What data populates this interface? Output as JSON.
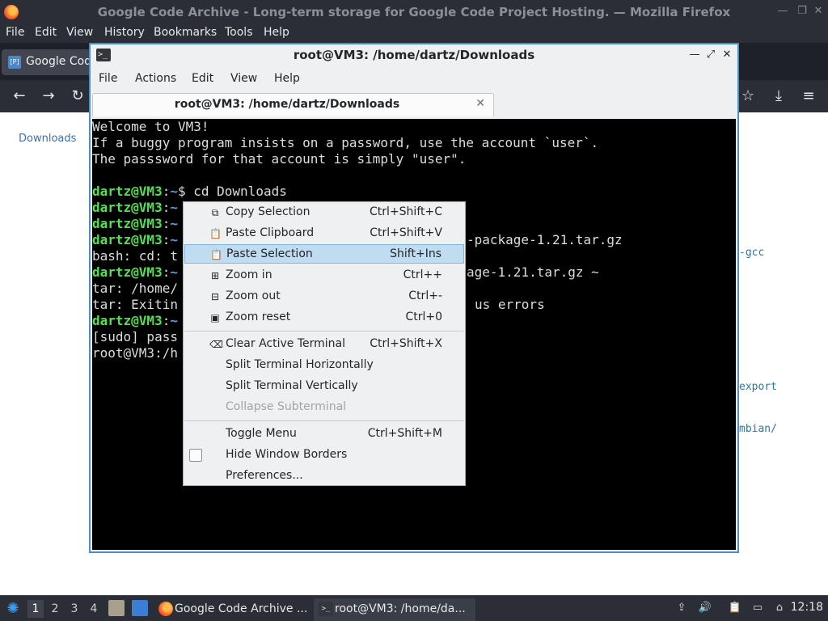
{
  "firefox": {
    "title": "Google Code Archive - Long-term storage for Google Code Project Hosting. — Mozilla Firefox",
    "menu": [
      "File",
      "Edit",
      "View",
      "History",
      "Bookmarks",
      "Tools",
      "Help"
    ],
    "tab_label": "Google Code",
    "tab_favicon": "[P]",
    "content": {
      "downloads_link": "Downloads",
      "side_text_1": "-gcc",
      "side_text_2": "export",
      "side_text_3": "mbian/"
    },
    "nav_icons": [
      "back-icon",
      "forward-icon",
      "reload-icon",
      "bookmark-star-icon",
      "download-icon",
      "hamburger-menu-icon"
    ]
  },
  "terminal": {
    "title": "root@VM3: /home/dartz/Downloads",
    "menu": [
      "File",
      "Actions",
      "Edit",
      "View",
      "Help"
    ],
    "tab_label": "root@VM3: /home/dartz/Downloads",
    "lines": {
      "l1": "Welcome to VM3!",
      "l2": "If a buggy program insists on a password, use the account `user`.",
      "l3": "The passsword for that account is simply \"user\".",
      "p1_user": "dartz@VM3",
      "p1_path": "~",
      "p1_cmd": "$ cd Downloads",
      "p2_user": "dartz@VM3",
      "p2_path": "~",
      "p3_user": "dartz@VM3",
      "p3_path": "~",
      "p4_user": "dartz@VM3",
      "p4_path": "~",
      "p4_tail": "-package-1.21.tar.gz",
      "l5_start": "bash: cd: t",
      "p6_user": "dartz@VM3",
      "p6_path": "~",
      "p6_tail": "age-1.21.tar.gz ~",
      "l7_start": "tar: /home/",
      "l8_start": "tar: Exitin",
      "l8_tail": "us errors",
      "p9_user": "dartz@VM3",
      "p9_path": "~",
      "l10_start": "[sudo] pass",
      "l11_start": "root@VM3:/h"
    }
  },
  "context_menu": {
    "items": [
      {
        "label": "Copy Selection",
        "shortcut": "Ctrl+Shift+C",
        "icon": "copy-icon"
      },
      {
        "label": "Paste Clipboard",
        "shortcut": "Ctrl+Shift+V",
        "icon": "paste-icon"
      },
      {
        "label": "Paste Selection",
        "shortcut": "Shift+Ins",
        "icon": "paste-icon"
      },
      {
        "label": "Zoom in",
        "shortcut": "Ctrl++",
        "icon": "zoom-in-icon"
      },
      {
        "label": "Zoom out",
        "shortcut": "Ctrl+-",
        "icon": "zoom-out-icon"
      },
      {
        "label": "Zoom reset",
        "shortcut": "Ctrl+0",
        "icon": "zoom-reset-icon"
      },
      {
        "label": "Clear Active Terminal",
        "shortcut": "Ctrl+Shift+X",
        "icon": "clear-icon"
      },
      {
        "label": "Split Terminal Horizontally",
        "shortcut": ""
      },
      {
        "label": "Split Terminal Vertically",
        "shortcut": ""
      },
      {
        "label": "Collapse Subterminal",
        "shortcut": "",
        "disabled": true
      },
      {
        "label": "Toggle Menu",
        "shortcut": "Ctrl+Shift+M"
      },
      {
        "label": "Hide Window Borders",
        "shortcut": "",
        "checkbox": true,
        "checked": false
      },
      {
        "label": "Preferences...",
        "shortcut": ""
      }
    ],
    "highlighted": "Paste Selection"
  },
  "taskbar": {
    "workspaces": [
      "1",
      "2",
      "3",
      "4"
    ],
    "active_workspace": "1",
    "tasks": [
      {
        "label": "Google Code Archive ...",
        "icon": "firefox-icon"
      },
      {
        "label": "root@VM3: /home/da...",
        "icon": "terminal-icon"
      }
    ],
    "clock": "12:18"
  },
  "colors": {
    "accent": "#4a90c8",
    "menu_highlight": "#bfdcf0",
    "prompt_user": "#4fe24f",
    "prompt_path": "#5e9ded"
  }
}
